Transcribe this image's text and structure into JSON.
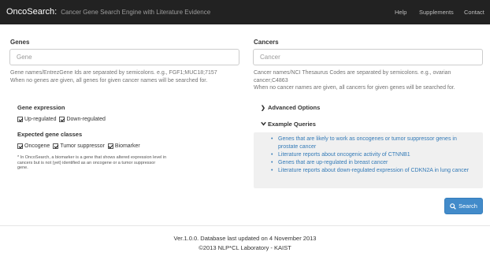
{
  "navbar": {
    "brand": "OncoSearch:",
    "tagline": "Cancer Gene Search Engine with Literature Evidence",
    "links": [
      "Help",
      "Supplements",
      "Contact"
    ]
  },
  "genes": {
    "label": "Genes",
    "placeholder": "Gene",
    "value": "",
    "help_line1": "Gene names/EntrezGene Ids are separated by semicolons. e.g., FGF1;MUC18;7157",
    "help_line2": "When no genes are given, all genes for given cancer names will be searched for."
  },
  "cancers": {
    "label": "Cancers",
    "placeholder": "Cancer",
    "value": "",
    "help_line1": "Cancer names/NCI Thesaurus Codes are separated by semicolons. e.g., ovarian",
    "help_line2": "cancer;C4863",
    "help_line3": "When no cancer names are given, all cancers for given genes will be searched for."
  },
  "gene_expression": {
    "title": "Gene expression",
    "options": [
      {
        "label": "Up-regulated",
        "checked": true
      },
      {
        "label": "Down-regulated",
        "checked": true
      }
    ]
  },
  "gene_classes": {
    "title": "Expected gene classes",
    "options": [
      {
        "label": "Oncogene",
        "checked": true
      },
      {
        "label": "Tumor suppressor",
        "checked": true
      },
      {
        "label": "Biomarker",
        "checked": true
      }
    ],
    "note_line1": "* In OncoSearch, a biomarker is a gene that shows altered expression level in",
    "note_line2": "cancers but is not (yet) identified as an oncogene or a tumor suppressor",
    "note_line3": "gene."
  },
  "advanced_options": {
    "label": "Advanced Options",
    "chevron": "chevron-right-icon"
  },
  "example_queries": {
    "label": "Example Queries",
    "chevron": "chevron-down-icon",
    "items": [
      "Genes that are likely to work as oncogenes or tumor suppressor genes in",
      "prostate cancer",
      "Literature reports about oncogenic activity of CTNNB1",
      "Genes that are up-regulated in breast cancer",
      "Literature reports about down-regulated expression of CDKN2A in lung cancer"
    ]
  },
  "search_button": {
    "label": "Search",
    "icon": "search-icon",
    "color": "#428bca"
  },
  "footer": {
    "version": "Ver.1.0.0. Database last updated on 4 November 2013",
    "copyright": "©2013 NLP*CL Laboratory - KAIST"
  },
  "colors": {
    "navbar": "#222222",
    "link": "#337ab7",
    "panel": "#f0f0f0"
  }
}
